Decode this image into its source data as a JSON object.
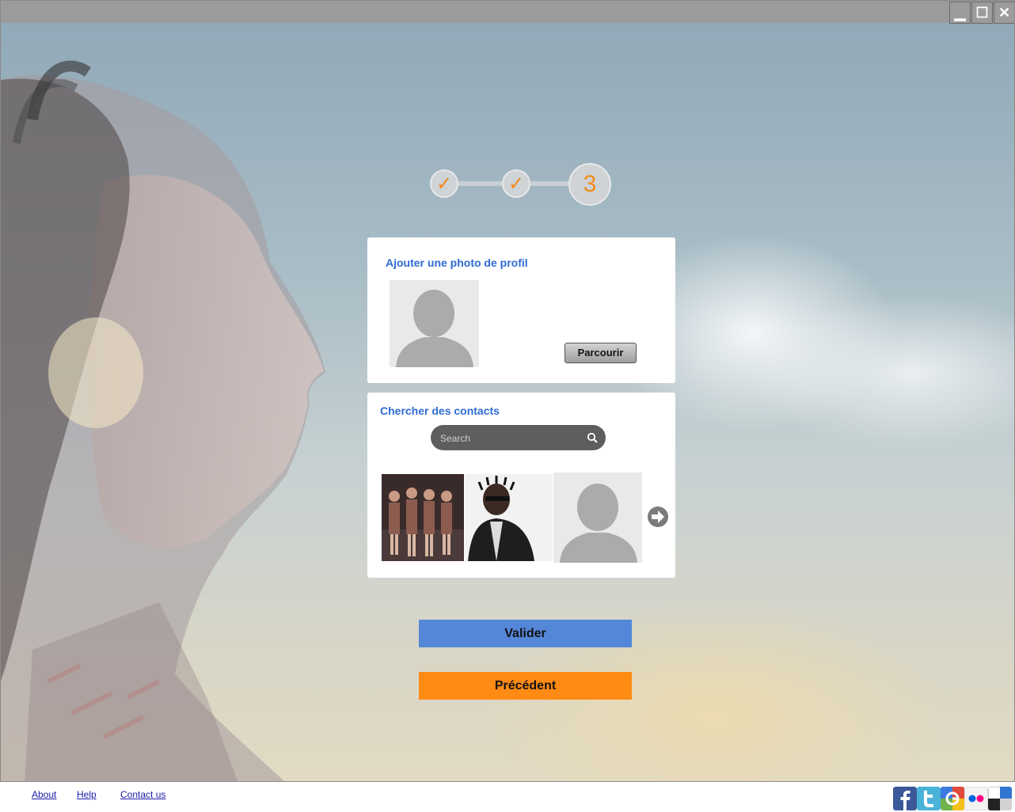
{
  "window": {
    "controls": {
      "minimize": "▁",
      "maximize": "☐",
      "close": "✕"
    }
  },
  "steps": {
    "done_mark": "✓",
    "current": "3"
  },
  "profile_photo": {
    "title": "Ajouter une photo de profil",
    "browse_label": "Parcourir"
  },
  "contacts": {
    "title": "Chercher des contacts",
    "search_placeholder": "Search"
  },
  "actions": {
    "validate_label": "Valider",
    "previous_label": "Précédent"
  },
  "footer": {
    "links": [
      "About",
      "Help",
      "Contact us"
    ]
  },
  "social_icons": [
    "facebook-icon",
    "twitter-icon",
    "google-icon",
    "flickr-icon",
    "delicious-icon"
  ],
  "colors": {
    "accent_blue": "#5487d8",
    "accent_orange": "#ff8a14",
    "title_blue": "#2f6bd3",
    "step_orange": "#f28c1b"
  }
}
